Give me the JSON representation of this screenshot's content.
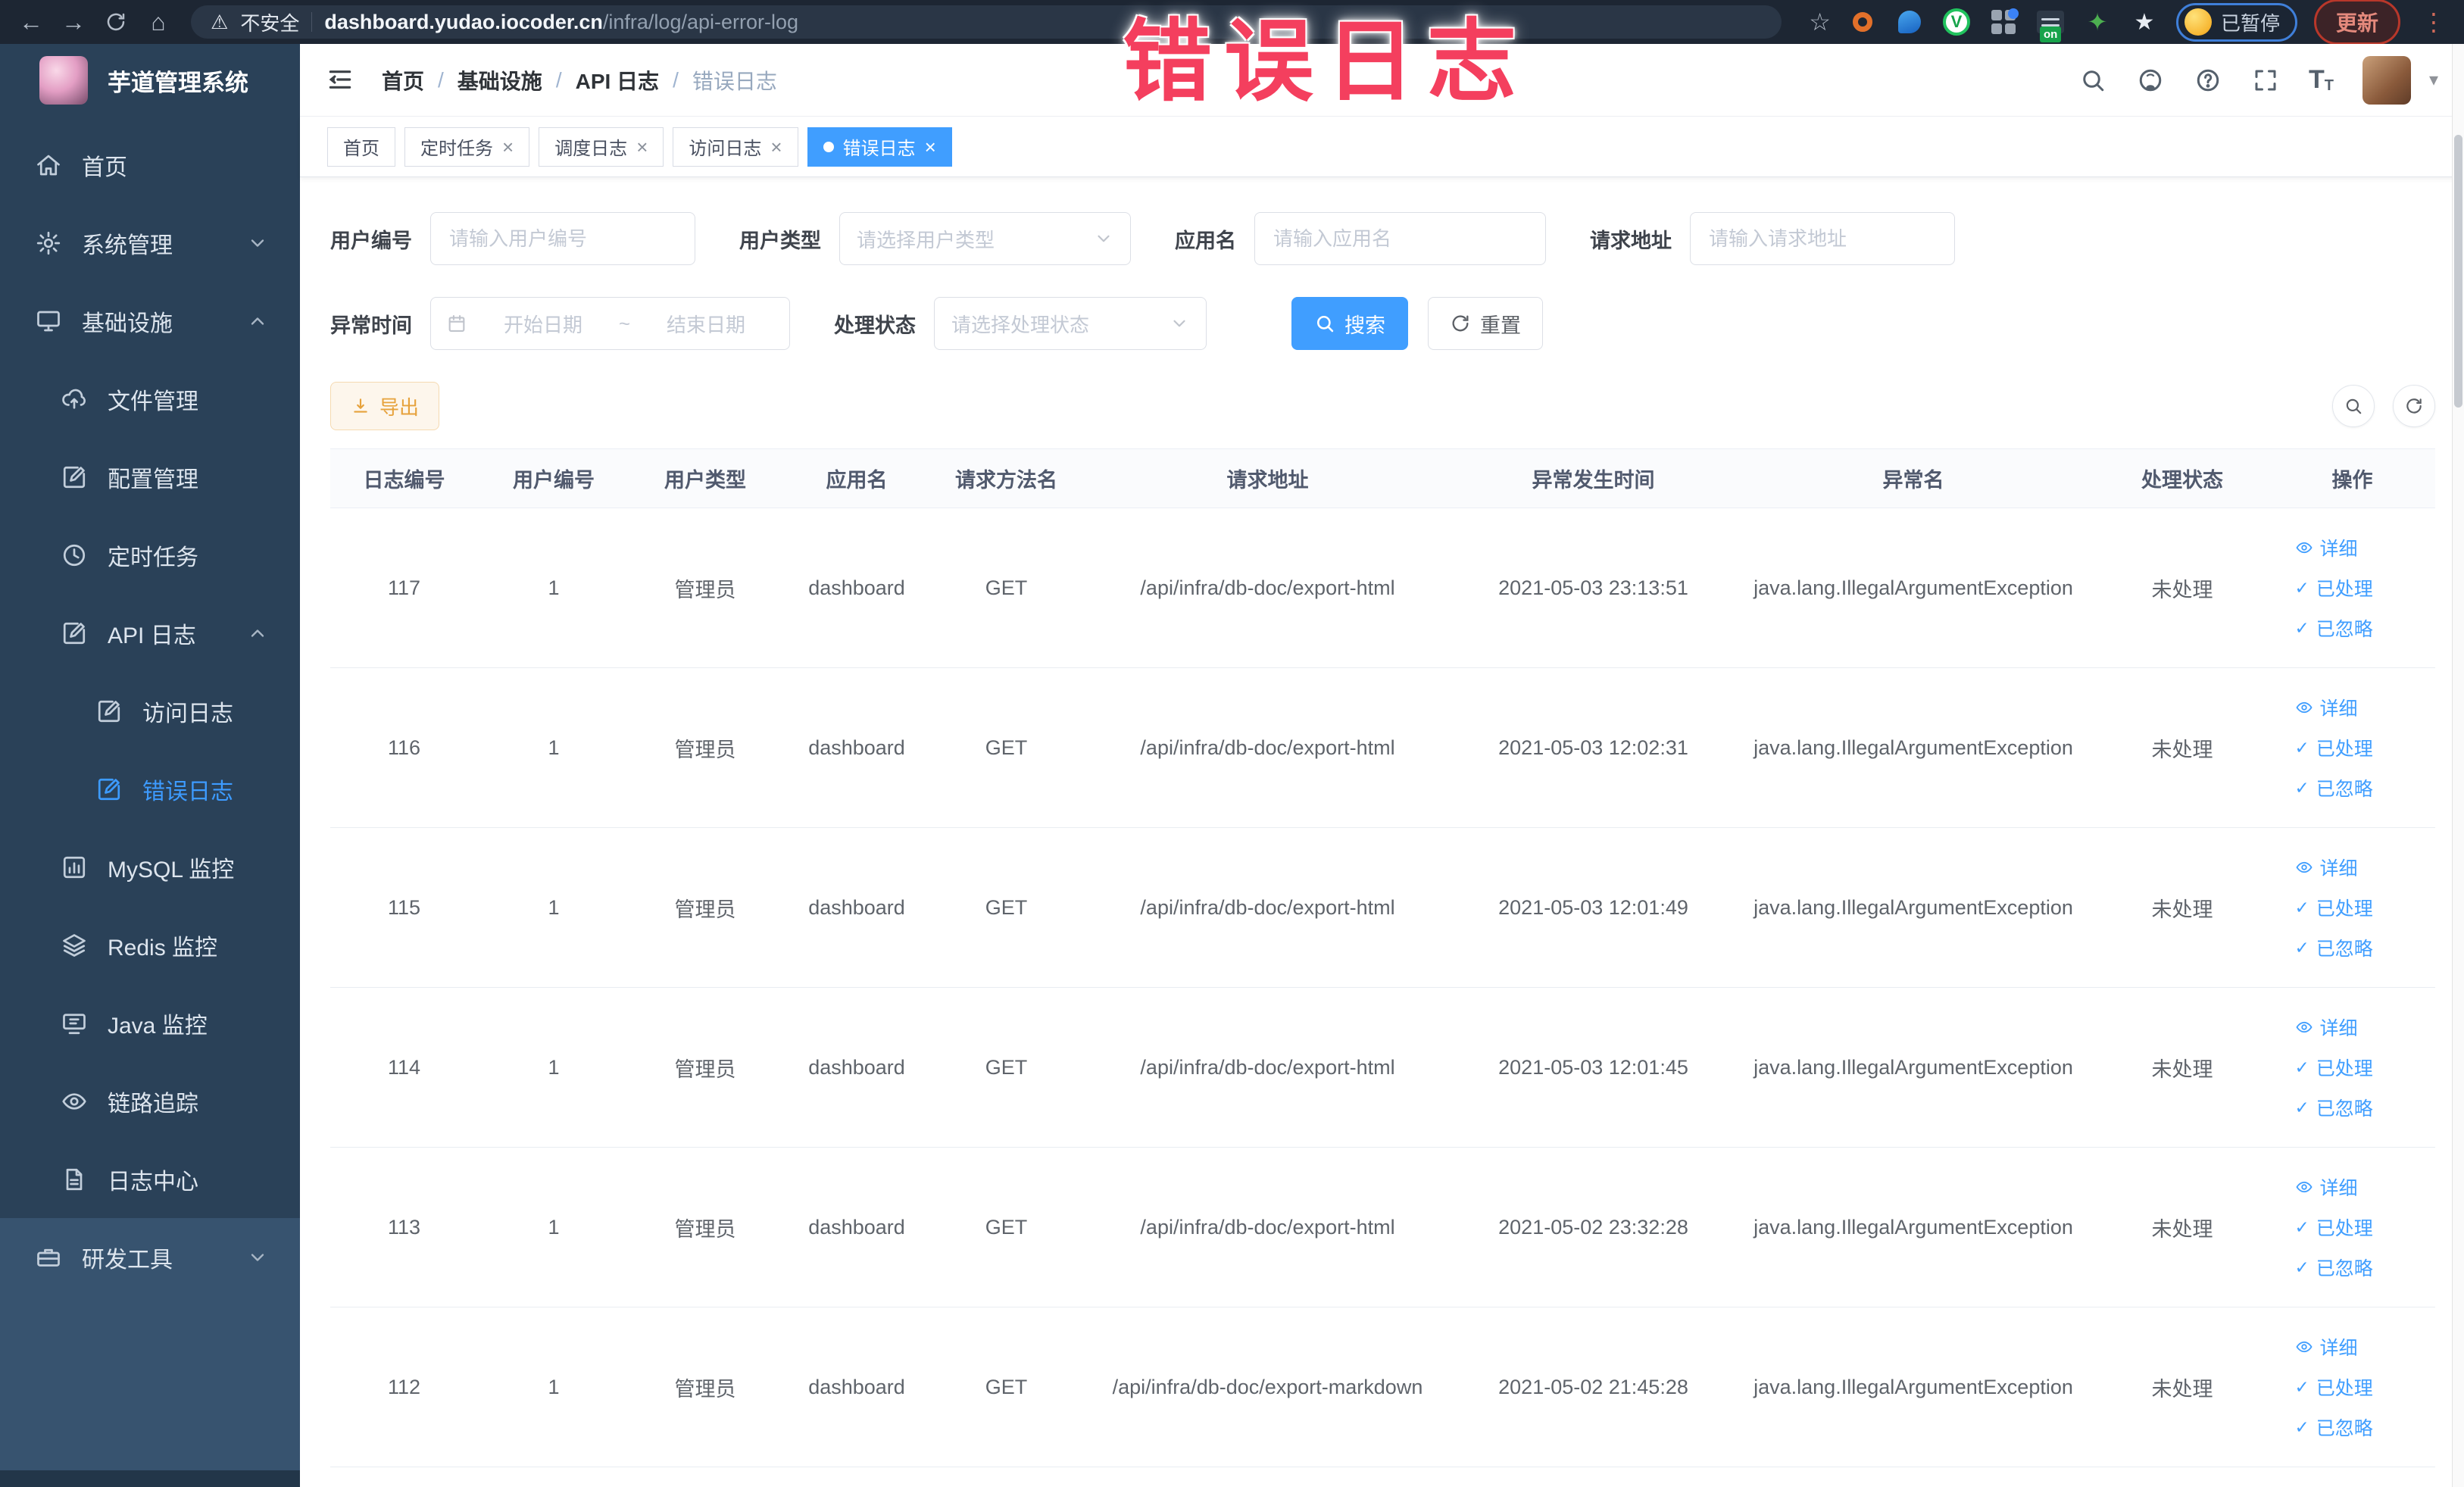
{
  "overlay": {
    "text": "错误日志"
  },
  "browser": {
    "security_label": "不安全",
    "url_host": "dashboard.yudao.iocoder.cn",
    "url_path": "/infra/log/api-error-log",
    "extension_switch_label": "on",
    "paused_badge": "已暂停",
    "update_badge": "更新"
  },
  "sidebar": {
    "title": "芋道管理系统",
    "items": [
      {
        "label": "首页",
        "icon": "home-icon"
      },
      {
        "label": "系统管理",
        "icon": "gear-icon",
        "chevron": "down"
      },
      {
        "label": "基础设施",
        "icon": "monitor-icon",
        "chevron": "up"
      },
      {
        "label": "文件管理",
        "icon": "cloud-upload-icon"
      },
      {
        "label": "配置管理",
        "icon": "edit-icon"
      },
      {
        "label": "定时任务",
        "icon": "history-icon"
      },
      {
        "label": "API 日志",
        "icon": "edit-icon",
        "chevron": "up"
      },
      {
        "label": "访问日志",
        "icon": "edit-icon"
      },
      {
        "label": "错误日志",
        "icon": "edit-icon",
        "active": true
      },
      {
        "label": "MySQL 监控",
        "icon": "chart-icon"
      },
      {
        "label": "Redis 监控",
        "icon": "layers-icon"
      },
      {
        "label": "Java 监控",
        "icon": "java-monitor-icon"
      },
      {
        "label": "链路追踪",
        "icon": "eye-icon"
      },
      {
        "label": "日志中心",
        "icon": "document-icon"
      },
      {
        "label": "研发工具",
        "icon": "toolbox-icon",
        "chevron": "down"
      }
    ]
  },
  "header": {
    "breadcrumb": [
      "首页",
      "基础设施",
      "API 日志",
      "错误日志"
    ]
  },
  "tabs": [
    {
      "label": "首页",
      "closable": false,
      "active": false
    },
    {
      "label": "定时任务",
      "closable": true,
      "active": false
    },
    {
      "label": "调度日志",
      "closable": true,
      "active": false
    },
    {
      "label": "访问日志",
      "closable": true,
      "active": false
    },
    {
      "label": "错误日志",
      "closable": true,
      "active": true
    }
  ],
  "filters": {
    "user_id": {
      "label": "用户编号",
      "placeholder": "请输入用户编号"
    },
    "user_type": {
      "label": "用户类型",
      "placeholder": "请选择用户类型"
    },
    "app_name": {
      "label": "应用名",
      "placeholder": "请输入应用名"
    },
    "request_url": {
      "label": "请求地址",
      "placeholder": "请输入请求地址"
    },
    "exception_time": {
      "label": "异常时间",
      "start_placeholder": "开始日期",
      "separator": "~",
      "end_placeholder": "结束日期"
    },
    "process_status": {
      "label": "处理状态",
      "placeholder": "请选择处理状态"
    },
    "search_label": "搜索",
    "reset_label": "重置"
  },
  "toolbar": {
    "export_label": "导出"
  },
  "table": {
    "columns": [
      "日志编号",
      "用户编号",
      "用户类型",
      "应用名",
      "请求方法名",
      "请求地址",
      "异常发生时间",
      "异常名",
      "处理状态",
      "操作"
    ],
    "actions": {
      "detail": "详细",
      "processed": "已处理",
      "ignored": "已忽略"
    },
    "rows": [
      {
        "log_id": "117",
        "user_id": "1",
        "user_type": "管理员",
        "app_name": "dashboard",
        "method": "GET",
        "url": "/api/infra/db-doc/export-html",
        "time": "2021-05-03 23:13:51",
        "exception": "java.lang.IllegalArgumentException",
        "status": "未处理"
      },
      {
        "log_id": "116",
        "user_id": "1",
        "user_type": "管理员",
        "app_name": "dashboard",
        "method": "GET",
        "url": "/api/infra/db-doc/export-html",
        "time": "2021-05-03 12:02:31",
        "exception": "java.lang.IllegalArgumentException",
        "status": "未处理"
      },
      {
        "log_id": "115",
        "user_id": "1",
        "user_type": "管理员",
        "app_name": "dashboard",
        "method": "GET",
        "url": "/api/infra/db-doc/export-html",
        "time": "2021-05-03 12:01:49",
        "exception": "java.lang.IllegalArgumentException",
        "status": "未处理"
      },
      {
        "log_id": "114",
        "user_id": "1",
        "user_type": "管理员",
        "app_name": "dashboard",
        "method": "GET",
        "url": "/api/infra/db-doc/export-html",
        "time": "2021-05-03 12:01:45",
        "exception": "java.lang.IllegalArgumentException",
        "status": "未处理"
      },
      {
        "log_id": "113",
        "user_id": "1",
        "user_type": "管理员",
        "app_name": "dashboard",
        "method": "GET",
        "url": "/api/infra/db-doc/export-html",
        "time": "2021-05-02 23:32:28",
        "exception": "java.lang.IllegalArgumentException",
        "status": "未处理"
      },
      {
        "log_id": "112",
        "user_id": "1",
        "user_type": "管理员",
        "app_name": "dashboard",
        "method": "GET",
        "url": "/api/infra/db-doc/export-markdown",
        "time": "2021-05-02 21:45:28",
        "exception": "java.lang.IllegalArgumentException",
        "status": "未处理"
      }
    ]
  },
  "colors": {
    "accent": "#409eff",
    "warning": "#e6a23c",
    "overlay_pink": "#f43f5e",
    "sidebar_bg": "#2a4158"
  }
}
